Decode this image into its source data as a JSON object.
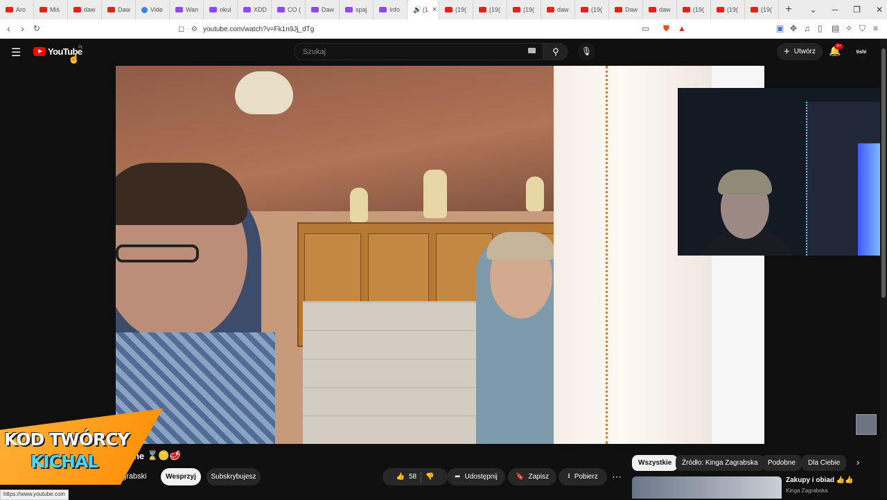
{
  "browser": {
    "tabs": [
      {
        "label": "Aro",
        "icon": "youtube"
      },
      {
        "label": "Miś",
        "icon": "youtube"
      },
      {
        "label": "daw",
        "icon": "youtube"
      },
      {
        "label": "Daw",
        "icon": "youtube"
      },
      {
        "label": "Vide",
        "icon": "google"
      },
      {
        "label": "Wan",
        "icon": "twitch"
      },
      {
        "label": "okul",
        "icon": "twitch"
      },
      {
        "label": "XDD",
        "icon": "twitch"
      },
      {
        "label": "CO (",
        "icon": "twitch"
      },
      {
        "label": "Daw",
        "icon": "twitch"
      },
      {
        "label": "spaj",
        "icon": "twitch"
      },
      {
        "label": "Info",
        "icon": "twitch"
      },
      {
        "label": "(1",
        "icon": "audio",
        "active": true
      },
      {
        "label": "(19(",
        "icon": "youtube"
      },
      {
        "label": "(19(",
        "icon": "youtube"
      },
      {
        "label": "(19(",
        "icon": "youtube"
      },
      {
        "label": "daw",
        "icon": "youtube"
      },
      {
        "label": "(19(",
        "icon": "youtube"
      },
      {
        "label": "Daw",
        "icon": "youtube"
      },
      {
        "label": "daw",
        "icon": "youtube"
      },
      {
        "label": "(19(",
        "icon": "youtube"
      },
      {
        "label": "(19(",
        "icon": "youtube"
      },
      {
        "label": "(19(",
        "icon": "youtube"
      }
    ],
    "new_tab": "+",
    "close_tab": "×",
    "url": "youtube.com/watch?v=Fk1n9Jj_dTg",
    "status_url": "https://www.youtube.com"
  },
  "masthead": {
    "logo_text": "YouTube",
    "country": "PL",
    "search_placeholder": "Szukaj",
    "create_label": "Utwórz",
    "notification_count": "9+",
    "avatar_text": "tishi"
  },
  "overlay": {
    "line1": "KOD TWÓRCY",
    "line2": "KICHAL"
  },
  "video": {
    "title_fragment": "one",
    "title_emojis": "⌛🪙🥩",
    "channel_fragment": "agrabski",
    "support_label": "Wesprzyj",
    "subscribed_label": "Subskrybujesz",
    "likes": "58",
    "share_label": "Udostępnij",
    "save_label": "Zapisz",
    "download_label": "Pobierz"
  },
  "sidebar": {
    "chips": [
      "Wszystkie",
      "Źródło: Kinga Zagrabska",
      "Podobne",
      "Dla Ciebie"
    ],
    "recommendation": {
      "title": "Zakupy i obiad 👍👍",
      "channel": "Kinga Zagrabska"
    }
  }
}
